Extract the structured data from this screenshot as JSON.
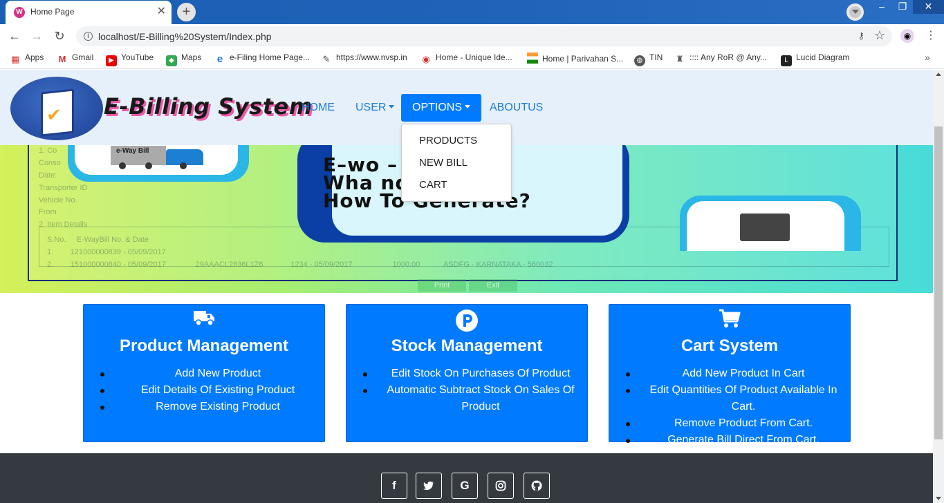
{
  "browser": {
    "tab_title": "Home Page",
    "url": "localhost/E-Billing%20System/Index.php",
    "bookmarks": [
      {
        "label": "Apps",
        "icon": "apps-grid-icon"
      },
      {
        "label": "Gmail",
        "icon": "gmail-icon"
      },
      {
        "label": "YouTube",
        "icon": "youtube-icon"
      },
      {
        "label": "Maps",
        "icon": "maps-icon"
      },
      {
        "label": "e-Filing Home Page...",
        "icon": "efiling-icon"
      },
      {
        "label": "https://www.nvsp.in",
        "icon": "nvsp-icon"
      },
      {
        "label": "Home - Unique Ide...",
        "icon": "aadhaar-icon"
      },
      {
        "label": "Home | Parivahan S...",
        "icon": "india-flag-icon"
      },
      {
        "label": "TIN",
        "icon": "globe-icon"
      },
      {
        "label": ":::: Any RoR @ Any...",
        "icon": "emblem-icon"
      },
      {
        "label": "Lucid Diagram",
        "icon": "lucid-icon"
      }
    ]
  },
  "navbar": {
    "brand": "E-Billing System",
    "links": {
      "home": "HOME",
      "user": "USER",
      "options": "OPTIONS",
      "about": "ABOUTUS"
    },
    "dropdown": {
      "products": "PRODUCTS",
      "new_bill": "NEW BILL",
      "cart": "CART"
    }
  },
  "hero": {
    "line1": "E–wo        –",
    "line2": "Wha        nd",
    "line3": "How To Generate?",
    "ewaybill_label": "e-Way Bill",
    "print": "Print",
    "exit": "Exit"
  },
  "cards": [
    {
      "title": "Product Management",
      "icon": "truck-icon",
      "items": [
        "Add New Product",
        "Edit Details Of Existing Product",
        "Remove Existing Product"
      ]
    },
    {
      "title": "Stock Management",
      "icon": "parking-p-icon",
      "items": [
        "Edit Stock On Purchases Of Product",
        "Automatic Subtract Stock On Sales Of Product"
      ]
    },
    {
      "title": "Cart System",
      "icon": "cart-icon",
      "items": [
        "Add New Product In Cart",
        "Edit Quantities Of Product Available In Cart.",
        "Remove Product From Cart.",
        "Generate Bill Direct From Cart."
      ]
    }
  ],
  "footer": {
    "social": [
      "facebook-icon",
      "twitter-icon",
      "google-icon",
      "instagram-icon",
      "github-icon"
    ]
  },
  "colors": {
    "primary": "#007bff",
    "navbar_bg": "#e6f0fb",
    "footer_bg": "#343a40",
    "brand_shadow": "#ec5aa8"
  }
}
